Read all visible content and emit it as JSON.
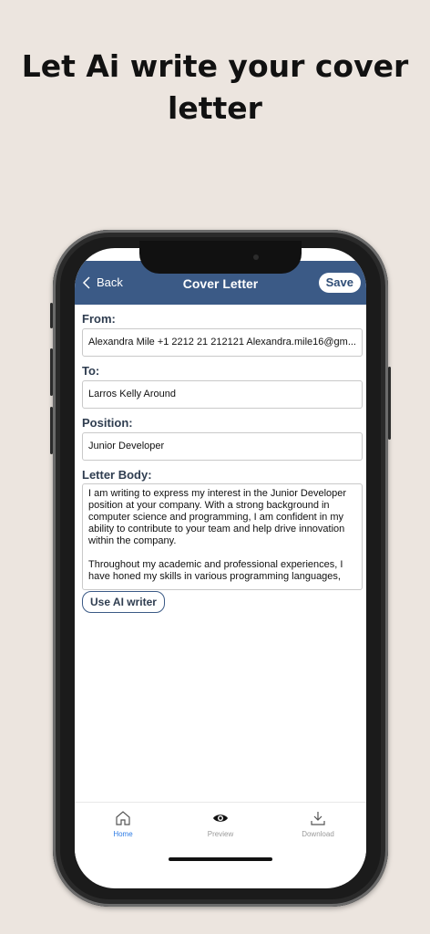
{
  "headline": {
    "line1": "Let Ai write your cover",
    "line2": "letter"
  },
  "navbar": {
    "back_label": "Back",
    "title": "Cover Letter",
    "save_label": "Save"
  },
  "form": {
    "from_label": "From:",
    "from_value": "Alexandra Mile +1 2212 21 212121 Alexandra.mile16@gm...",
    "to_label": "To:",
    "to_value": "Larros Kelly Around",
    "position_label": "Position:",
    "position_value": "Junior Developer",
    "body_label": "Letter Body:",
    "body_value": "I am writing to express my interest in the Junior Developer position at your company. With a strong background in computer science and programming, I am confident in my ability to contribute to your team and help drive innovation within the company.\n\nThroughout my academic and professional experiences, I have honed my skills in various programming languages,",
    "ai_button": "Use AI writer"
  },
  "tabs": [
    {
      "label": "Home",
      "icon": "home-icon",
      "active": true
    },
    {
      "label": "Preview",
      "icon": "eye-icon",
      "active": false
    },
    {
      "label": "Download",
      "icon": "download-icon",
      "active": false
    }
  ],
  "colors": {
    "navbar": "#3b5a86",
    "background": "#ece5df",
    "active_tab": "#2c7be5"
  }
}
